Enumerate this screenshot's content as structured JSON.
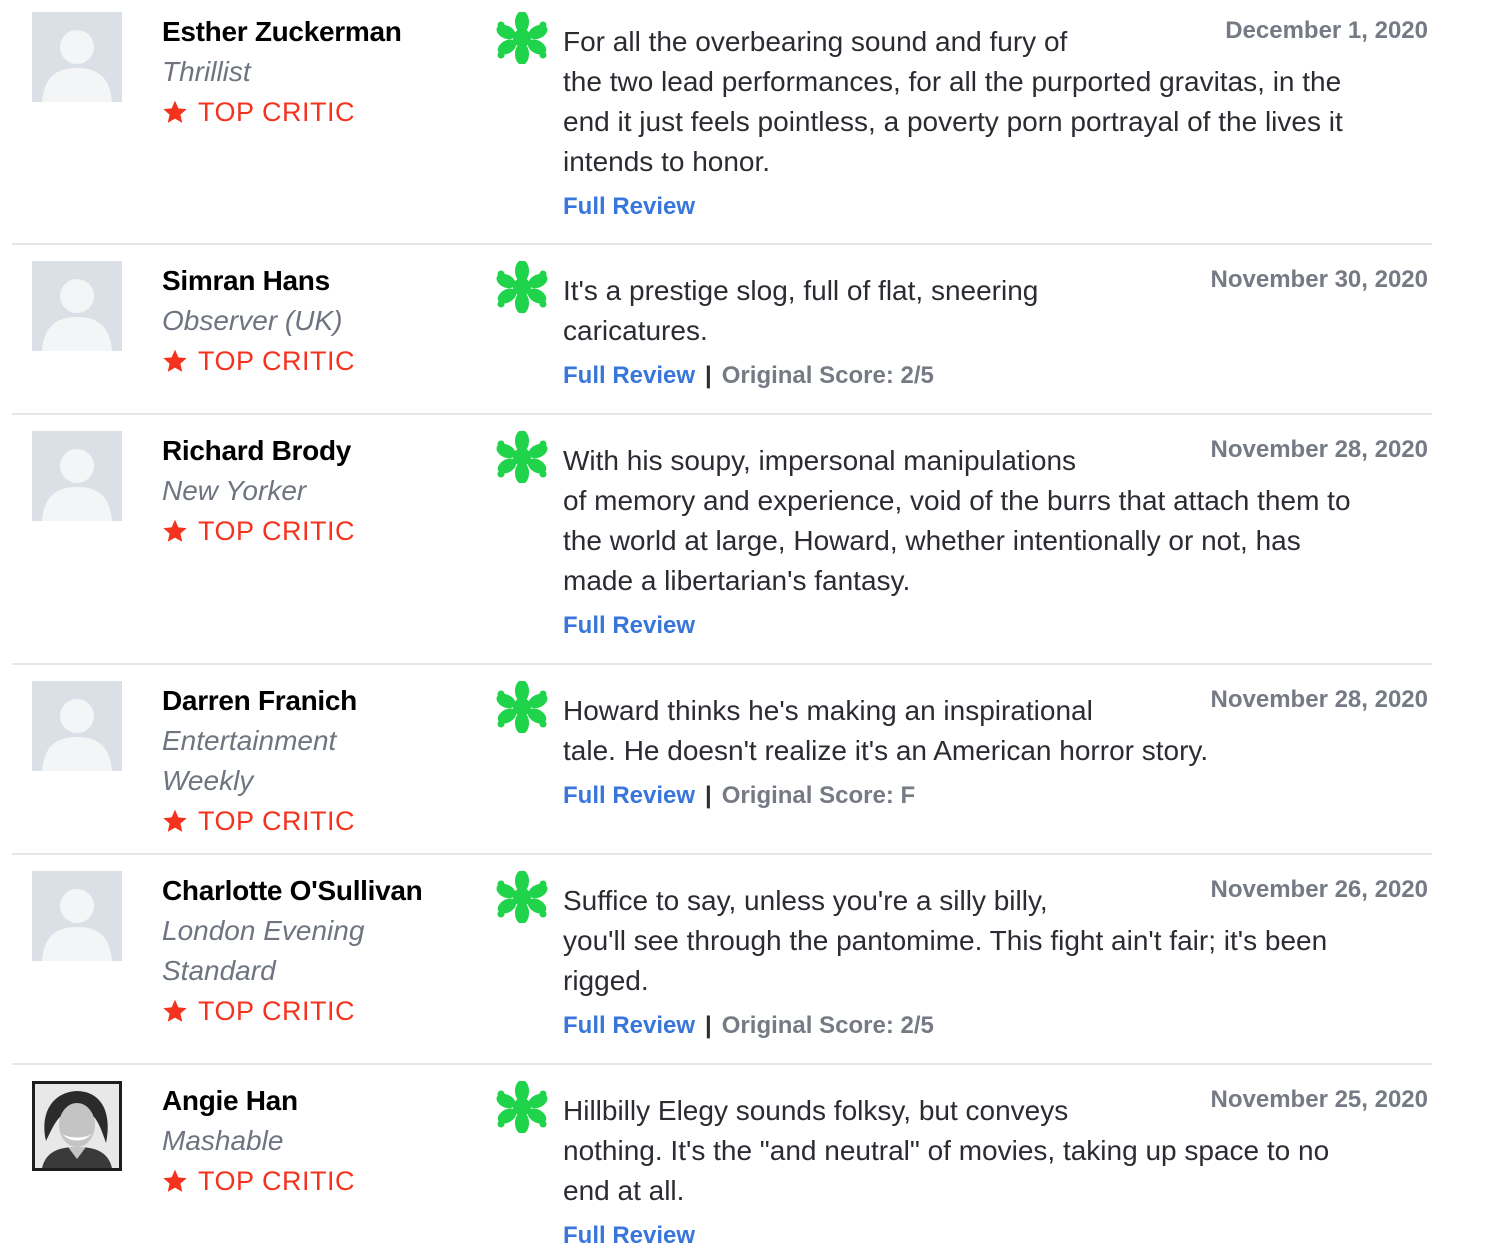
{
  "reviews": [
    {
      "critic": "Esther Zuckerman",
      "publication_lines": [
        "Thrillist"
      ],
      "top_critic": "TOP CRITIC",
      "date": "December 1, 2020",
      "quote_first": "For all the overbearing sound and fury of",
      "quote_rest": [
        "the two lead performances, for all the purported gravitas, in the",
        "end it just feels pointless, a poverty porn portrayal of the lives it",
        "intends to honor."
      ],
      "full_review": "Full Review",
      "original_score": "",
      "avatar": "placeholder"
    },
    {
      "critic": "Simran Hans",
      "publication_lines": [
        "Observer (UK)"
      ],
      "top_critic": "TOP CRITIC",
      "date": "November 30, 2020",
      "quote_first": "It's a prestige slog, full of flat, sneering",
      "quote_rest": [
        "caricatures."
      ],
      "full_review": "Full Review",
      "original_score": "Original Score: 2/5",
      "avatar": "placeholder"
    },
    {
      "critic": "Richard Brody",
      "publication_lines": [
        "New Yorker"
      ],
      "top_critic": "TOP CRITIC",
      "date": "November 28, 2020",
      "quote_first": "With his soupy, impersonal manipulations",
      "quote_rest": [
        "of memory and experience, void of the burrs that attach them to",
        "the world at large, Howard, whether intentionally or not, has",
        "made a libertarian's fantasy."
      ],
      "full_review": "Full Review",
      "original_score": "",
      "avatar": "placeholder"
    },
    {
      "critic": "Darren Franich",
      "publication_lines": [
        "Entertainment",
        "Weekly"
      ],
      "top_critic": "TOP CRITIC",
      "date": "November 28, 2020",
      "quote_first": "Howard thinks he's making an inspirational",
      "quote_rest": [
        "tale. He doesn't realize it's an American horror story."
      ],
      "full_review": "Full Review",
      "original_score": "Original Score: F",
      "avatar": "placeholder"
    },
    {
      "critic": "Charlotte O'Sullivan",
      "publication_lines": [
        "London Evening",
        "Standard"
      ],
      "top_critic": "TOP CRITIC",
      "date": "November 26, 2020",
      "quote_first": "Suffice to say, unless you're a silly billy,",
      "quote_rest": [
        "you'll see through the pantomime. This fight ain't fair; it's been",
        "rigged."
      ],
      "full_review": "Full Review",
      "original_score": "Original Score: 2/5",
      "avatar": "placeholder"
    },
    {
      "critic": "Angie Han",
      "publication_lines": [
        "Mashable"
      ],
      "top_critic": "TOP CRITIC",
      "date": "November 25, 2020",
      "quote_first": "Hillbilly Elegy sounds folksy, but conveys",
      "quote_rest": [
        "nothing. It's the \"and neutral\" of movies, taking up space to no",
        "end at all."
      ],
      "full_review": "Full Review",
      "original_score": "",
      "avatar": "photo"
    }
  ],
  "separator": "|",
  "icons": {
    "score": "rotten-splat-icon",
    "top_critic": "star-icon",
    "avatar": "user-avatar-icon"
  },
  "colors": {
    "splat_green": "#1fd44a",
    "top_critic_red": "#f5321e",
    "link_blue": "#3976dc",
    "muted_gray": "#757a84"
  }
}
